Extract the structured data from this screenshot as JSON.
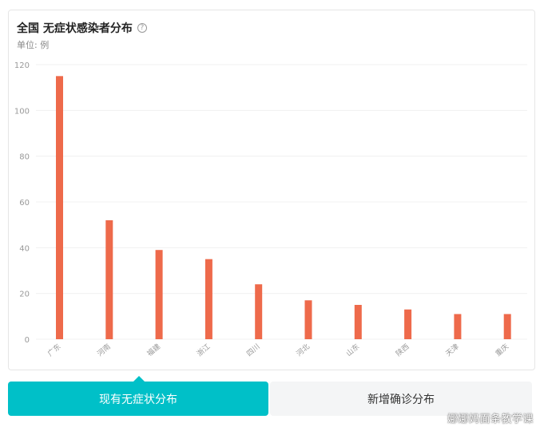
{
  "header": {
    "title": "全国 无症状感染者分布",
    "help_icon": "?",
    "unit": "单位: 例"
  },
  "tabs": [
    {
      "label": "现有无症状分布",
      "active": true
    },
    {
      "label": "新增确诊分布",
      "active": false
    }
  ],
  "watermark": "娜娜妈面条教学课",
  "colors": {
    "bar": "#ee6a4b",
    "accent": "#00c0c8",
    "inactive_tab": "#f4f5f6"
  },
  "chart_data": {
    "type": "bar",
    "title": "全国 无症状感染者分布",
    "ylabel": "单位: 例",
    "xlabel": "",
    "categories": [
      "广东",
      "河南",
      "福建",
      "浙江",
      "四川",
      "河北",
      "山东",
      "陕西",
      "天津",
      "重庆"
    ],
    "values": [
      115,
      52,
      39,
      35,
      24,
      17,
      15,
      13,
      11,
      11
    ],
    "ylim": [
      0,
      120
    ],
    "yticks": [
      0,
      20,
      40,
      60,
      80,
      100,
      120
    ],
    "grid": true,
    "legend": "none"
  }
}
